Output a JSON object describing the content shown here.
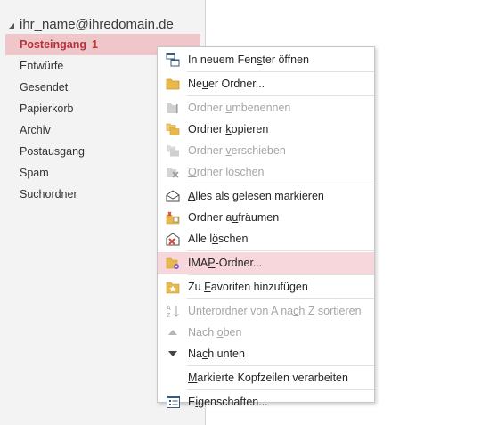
{
  "account": {
    "name": "ihr_name@ihredomain.de"
  },
  "folders": [
    {
      "label": "Posteingang",
      "count": "1",
      "selected": true
    },
    {
      "label": "Entwürfe"
    },
    {
      "label": "Gesendet"
    },
    {
      "label": "Papierkorb"
    },
    {
      "label": "Archiv"
    },
    {
      "label": "Postausgang"
    },
    {
      "label": "Spam"
    },
    {
      "label": "Suchordner"
    }
  ],
  "menu": {
    "open_new_window": {
      "pre": "In neuem Fen",
      "key": "s",
      "post": "ter öffnen"
    },
    "new_folder": {
      "pre": "Ne",
      "key": "u",
      "post": "er Ordner..."
    },
    "rename_folder": {
      "pre": "Ordner ",
      "key": "u",
      "post": "mbenennen"
    },
    "copy_folder": {
      "pre": "Ordner ",
      "key": "k",
      "post": "opieren"
    },
    "move_folder": {
      "pre": "Ordner ",
      "key": "v",
      "post": "erschieben"
    },
    "delete_folder": {
      "pre": "",
      "key": "O",
      "post": "rdner löschen"
    },
    "mark_all_read": {
      "pre": "",
      "key": "A",
      "post": "lles als gelesen markieren"
    },
    "clean_up_folder": {
      "pre": "Ordner a",
      "key": "u",
      "post": "fräumen"
    },
    "delete_all": {
      "pre": "Alle l",
      "key": "ö",
      "post": "schen"
    },
    "imap_folders": {
      "pre": "IMA",
      "key": "P",
      "post": "-Ordner..."
    },
    "add_to_favorites": {
      "pre": "Zu ",
      "key": "F",
      "post": "avoriten hinzufügen"
    },
    "sort_subfolders": {
      "pre": "Unterordner von A na",
      "key": "c",
      "post": "h Z sortieren"
    },
    "move_up": {
      "pre": "Nach ",
      "key": "o",
      "post": "ben"
    },
    "move_down": {
      "pre": "Na",
      "key": "c",
      "post": "h unten"
    },
    "process_headers": {
      "pre": "",
      "key": "M",
      "post": "arkierte Kopfzeilen verarbeiten"
    },
    "properties": {
      "pre": "E",
      "key": "i",
      "post": "genschaften..."
    }
  },
  "colors": {
    "accent": "#b4303a",
    "selection": "#efc6c9",
    "hover": "#f7d7db",
    "folder_icon": "#e8b84a"
  }
}
